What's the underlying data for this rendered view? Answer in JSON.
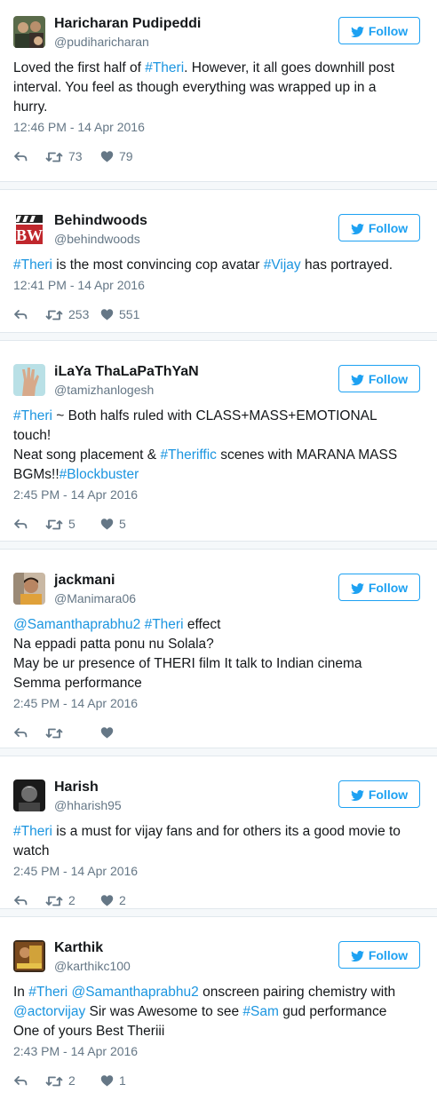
{
  "follow_label": "Follow",
  "colors": {
    "link": "#1b95e0",
    "follow": "#1da1f2",
    "meta": "#657786"
  },
  "tweets": [
    {
      "name": "Haricharan Pudipeddi",
      "handle": "@pudiharicharan",
      "lines": [
        [
          {
            "t": "Loved the first half of "
          },
          {
            "t": "#Theri",
            "link": true
          },
          {
            "t": ". However, it all goes downhill post"
          }
        ],
        [
          {
            "t": "interval. You feel as though everything was wrapped up in a"
          }
        ],
        [
          {
            "t": "hurry."
          }
        ]
      ],
      "time": "12:46 PM - 14 Apr 2016",
      "retweets": "73",
      "likes": "79",
      "avatar_icon": "people-photo"
    },
    {
      "name": "Behindwoods",
      "handle": "@behindwoods",
      "lines": [
        [
          {
            "t": "#Theri",
            "link": true
          },
          {
            "t": " is the most convincing cop avatar "
          },
          {
            "t": "#Vijay",
            "link": true
          },
          {
            "t": " has portrayed."
          }
        ]
      ],
      "time": "12:41 PM - 14 Apr 2016",
      "retweets": "253",
      "likes": "551",
      "avatar_icon": "bw-logo",
      "avatar_text": "BW"
    },
    {
      "name": "iLaYa ThaLaPaThYaN",
      "handle": "@tamizhanlogesh",
      "lines": [
        [
          {
            "t": "#Theri",
            "link": true
          },
          {
            "t": " ~ Both halfs ruled with CLASS+MASS+EMOTIONAL"
          }
        ],
        [
          {
            "t": "touch!"
          }
        ],
        [
          {
            "t": "Neat song placement & "
          },
          {
            "t": "#Theriffic",
            "link": true
          },
          {
            "t": " scenes with MARANA MASS"
          }
        ],
        [
          {
            "t": "BGMs!!"
          },
          {
            "t": "#Blockbuster",
            "link": true
          }
        ]
      ],
      "time": "2:45 PM - 14 Apr 2016",
      "retweets": "5",
      "likes": "5",
      "avatar_icon": "hand-photo"
    },
    {
      "name": "jackmani",
      "handle": "@Manimara06",
      "lines": [
        [
          {
            "t": "@Samanthaprabhu2",
            "link": true
          },
          {
            "t": " "
          },
          {
            "t": "#Theri",
            "link": true
          },
          {
            "t": " effect"
          }
        ],
        [
          {
            "t": "Na eppadi patta ponu nu Solala?"
          }
        ],
        [
          {
            "t": "May be ur presence of THERI film It talk to Indian cinema"
          }
        ],
        [
          {
            "t": "Semma performance"
          }
        ]
      ],
      "time": "2:45 PM - 14 Apr 2016",
      "retweets": "",
      "likes": "",
      "avatar_icon": "man-photo"
    },
    {
      "name": "Harish",
      "handle": "@hharish95",
      "lines": [
        [
          {
            "t": "#Theri",
            "link": true
          },
          {
            "t": " is a must for vijay fans and for others its a good movie to"
          }
        ],
        [
          {
            "t": "watch"
          }
        ]
      ],
      "time": "2:45 PM - 14 Apr 2016",
      "retweets": "2",
      "likes": "2",
      "avatar_icon": "dark-portrait"
    },
    {
      "name": "Karthik",
      "handle": "@karthikc100",
      "lines": [
        [
          {
            "t": "In "
          },
          {
            "t": "#Theri",
            "link": true
          },
          {
            "t": " "
          },
          {
            "t": "@Samanthaprabhu2",
            "link": true
          },
          {
            "t": " onscreen pairing chemistry with"
          }
        ],
        [
          {
            "t": "@actorvijay",
            "link": true
          },
          {
            "t": " Sir was Awesome to see "
          },
          {
            "t": "#Sam",
            "link": true
          },
          {
            "t": " gud performance"
          }
        ],
        [
          {
            "t": "One of yours Best Theriii"
          }
        ]
      ],
      "time": "2:43 PM - 14 Apr 2016",
      "retweets": "2",
      "likes": "1",
      "avatar_icon": "movie-poster"
    }
  ]
}
